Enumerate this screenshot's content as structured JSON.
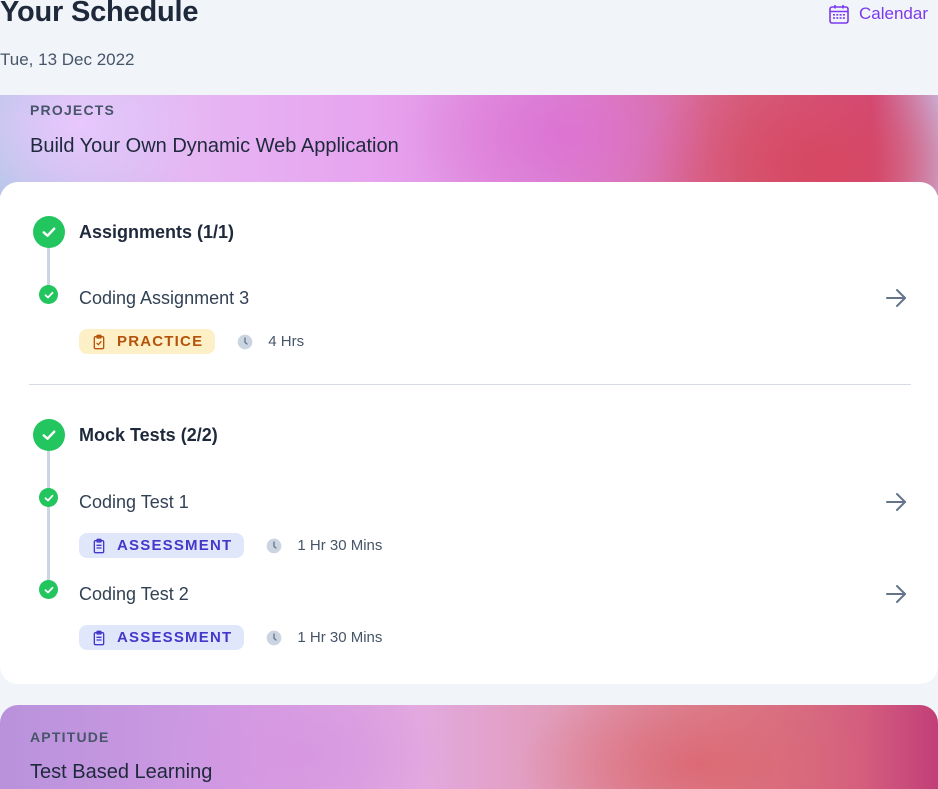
{
  "header": {
    "title": "Your Schedule",
    "date": "Tue, 13 Dec 2022",
    "calendar_label": "Calendar"
  },
  "sections": [
    {
      "eyebrow": "PROJECTS",
      "title": "Build Your Own Dynamic Web Application",
      "groups": [
        {
          "label": "Assignments (1/1)",
          "items": [
            {
              "title": "Coding Assignment 3",
              "tag": "PRACTICE",
              "duration": "4 Hrs"
            }
          ]
        },
        {
          "label": "Mock Tests (2/2)",
          "items": [
            {
              "title": "Coding Test 1",
              "tag": "ASSESSMENT",
              "duration": "1 Hr 30 Mins"
            },
            {
              "title": "Coding Test 2",
              "tag": "ASSESSMENT",
              "duration": "1 Hr 30 Mins"
            }
          ]
        }
      ]
    },
    {
      "eyebrow": "APTITUDE",
      "title": "Test Based Learning"
    }
  ],
  "icons": {
    "calendar": "calendar-icon",
    "check": "check-circle-icon",
    "arrow": "arrow-right-icon",
    "clipboard": "clipboard-icon",
    "clock": "clock-icon"
  },
  "colors": {
    "accent": "#7c3aed",
    "success": "#22c55e",
    "practice_bg": "#fdefc6",
    "practice_fg": "#b45309",
    "assessment_bg": "#e0e7fb",
    "assessment_fg": "#4338ca"
  }
}
